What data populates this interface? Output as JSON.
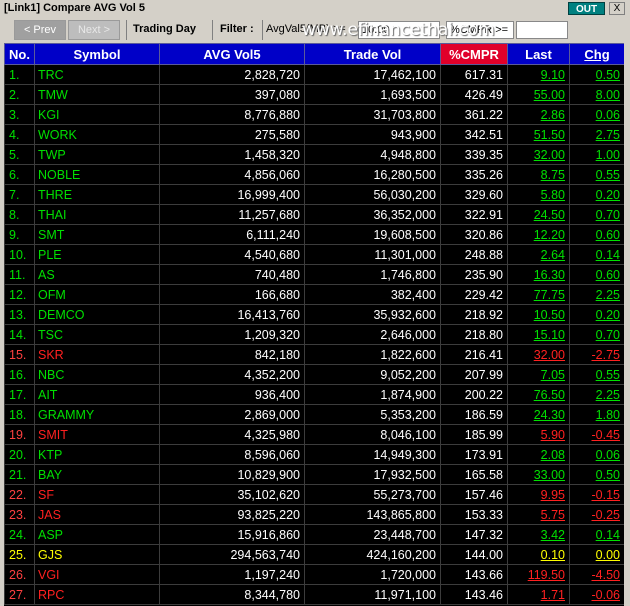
{
  "window": {
    "title": "[Link1] Compare AVG Vol 5",
    "out_label": "OUT",
    "close_label": "X"
  },
  "toolbar": {
    "prev_label": "< Prev",
    "next_label": "Next >",
    "trading_day_label": "Trading Day",
    "filter_label": "Filter :",
    "avgval_label": "AvgVal5(MB) >=",
    "avgval_value": "10.00",
    "cmpr_label": "%CMPR >=",
    "cmpr_value": "",
    "watermark": "www.efinancethai.com"
  },
  "table": {
    "headers": [
      "No.",
      "Symbol",
      "AVG Vol5",
      "Trade Vol",
      "%CMPR",
      "Last",
      "Chg"
    ],
    "rows": [
      {
        "no": "1.",
        "symbol": "TRC",
        "avg": "2,828,720",
        "trade": "17,462,100",
        "cmpr": "617.31",
        "last": "9.10",
        "chg": "0.50",
        "color": "g"
      },
      {
        "no": "2.",
        "symbol": "TMW",
        "avg": "397,080",
        "trade": "1,693,500",
        "cmpr": "426.49",
        "last": "55.00",
        "chg": "8.00",
        "color": "g"
      },
      {
        "no": "3.",
        "symbol": "KGI",
        "avg": "8,776,880",
        "trade": "31,703,800",
        "cmpr": "361.22",
        "last": "2.86",
        "chg": "0.06",
        "color": "g"
      },
      {
        "no": "4.",
        "symbol": "WORK",
        "avg": "275,580",
        "trade": "943,900",
        "cmpr": "342.51",
        "last": "51.50",
        "chg": "2.75",
        "color": "g"
      },
      {
        "no": "5.",
        "symbol": "TWP",
        "avg": "1,458,320",
        "trade": "4,948,800",
        "cmpr": "339.35",
        "last": "32.00",
        "chg": "1.00",
        "color": "g"
      },
      {
        "no": "6.",
        "symbol": "NOBLE",
        "avg": "4,856,060",
        "trade": "16,280,500",
        "cmpr": "335.26",
        "last": "8.75",
        "chg": "0.55",
        "color": "g"
      },
      {
        "no": "7.",
        "symbol": "THRE",
        "avg": "16,999,400",
        "trade": "56,030,200",
        "cmpr": "329.60",
        "last": "5.80",
        "chg": "0.20",
        "color": "g"
      },
      {
        "no": "8.",
        "symbol": "THAI",
        "avg": "11,257,680",
        "trade": "36,352,000",
        "cmpr": "322.91",
        "last": "24.50",
        "chg": "0.70",
        "color": "g"
      },
      {
        "no": "9.",
        "symbol": "SMT",
        "avg": "6,111,240",
        "trade": "19,608,500",
        "cmpr": "320.86",
        "last": "12.20",
        "chg": "0.60",
        "color": "g"
      },
      {
        "no": "10.",
        "symbol": "PLE",
        "avg": "4,540,680",
        "trade": "11,301,000",
        "cmpr": "248.88",
        "last": "2.64",
        "chg": "0.14",
        "color": "g"
      },
      {
        "no": "11.",
        "symbol": "AS",
        "avg": "740,480",
        "trade": "1,746,800",
        "cmpr": "235.90",
        "last": "16.30",
        "chg": "0.60",
        "color": "g"
      },
      {
        "no": "12.",
        "symbol": "OFM",
        "avg": "166,680",
        "trade": "382,400",
        "cmpr": "229.42",
        "last": "77.75",
        "chg": "2.25",
        "color": "g"
      },
      {
        "no": "13.",
        "symbol": "DEMCO",
        "avg": "16,413,760",
        "trade": "35,932,600",
        "cmpr": "218.92",
        "last": "10.50",
        "chg": "0.20",
        "color": "g"
      },
      {
        "no": "14.",
        "symbol": "TSC",
        "avg": "1,209,320",
        "trade": "2,646,000",
        "cmpr": "218.80",
        "last": "15.10",
        "chg": "0.70",
        "color": "g"
      },
      {
        "no": "15.",
        "symbol": "SKR",
        "avg": "842,180",
        "trade": "1,822,600",
        "cmpr": "216.41",
        "last": "32.00",
        "chg": "-2.75",
        "color": "r"
      },
      {
        "no": "16.",
        "symbol": "NBC",
        "avg": "4,352,200",
        "trade": "9,052,200",
        "cmpr": "207.99",
        "last": "7.05",
        "chg": "0.55",
        "color": "g"
      },
      {
        "no": "17.",
        "symbol": "AIT",
        "avg": "936,400",
        "trade": "1,874,900",
        "cmpr": "200.22",
        "last": "76.50",
        "chg": "2.25",
        "color": "g"
      },
      {
        "no": "18.",
        "symbol": "GRAMMY",
        "avg": "2,869,000",
        "trade": "5,353,200",
        "cmpr": "186.59",
        "last": "24.30",
        "chg": "1.80",
        "color": "g"
      },
      {
        "no": "19.",
        "symbol": "SMIT",
        "avg": "4,325,980",
        "trade": "8,046,100",
        "cmpr": "185.99",
        "last": "5.90",
        "chg": "-0.45",
        "color": "r"
      },
      {
        "no": "20.",
        "symbol": "KTP",
        "avg": "8,596,060",
        "trade": "14,949,300",
        "cmpr": "173.91",
        "last": "2.08",
        "chg": "0.06",
        "color": "g"
      },
      {
        "no": "21.",
        "symbol": "BAY",
        "avg": "10,829,900",
        "trade": "17,932,500",
        "cmpr": "165.58",
        "last": "33.00",
        "chg": "0.50",
        "color": "g"
      },
      {
        "no": "22.",
        "symbol": "SF",
        "avg": "35,102,620",
        "trade": "55,273,700",
        "cmpr": "157.46",
        "last": "9.95",
        "chg": "-0.15",
        "color": "r"
      },
      {
        "no": "23.",
        "symbol": "JAS",
        "avg": "93,825,220",
        "trade": "143,865,800",
        "cmpr": "153.33",
        "last": "5.75",
        "chg": "-0.25",
        "color": "r"
      },
      {
        "no": "24.",
        "symbol": "ASP",
        "avg": "15,916,860",
        "trade": "23,448,700",
        "cmpr": "147.32",
        "last": "3.42",
        "chg": "0.14",
        "color": "g"
      },
      {
        "no": "25.",
        "symbol": "GJS",
        "avg": "294,563,740",
        "trade": "424,160,200",
        "cmpr": "144.00",
        "last": "0.10",
        "chg": "0.00",
        "color": "y"
      },
      {
        "no": "26.",
        "symbol": "VGI",
        "avg": "1,197,240",
        "trade": "1,720,000",
        "cmpr": "143.66",
        "last": "119.50",
        "chg": "-4.50",
        "color": "r"
      },
      {
        "no": "27.",
        "symbol": "RPC",
        "avg": "8,344,780",
        "trade": "11,971,100",
        "cmpr": "143.46",
        "last": "1.71",
        "chg": "-0.06",
        "color": "r"
      }
    ]
  },
  "colors": {
    "header_bg": "#0000c8",
    "cmpr_header_bg": "#e0002a",
    "up": "#00e000",
    "down": "#ff2020",
    "unchanged": "#ffff00"
  }
}
